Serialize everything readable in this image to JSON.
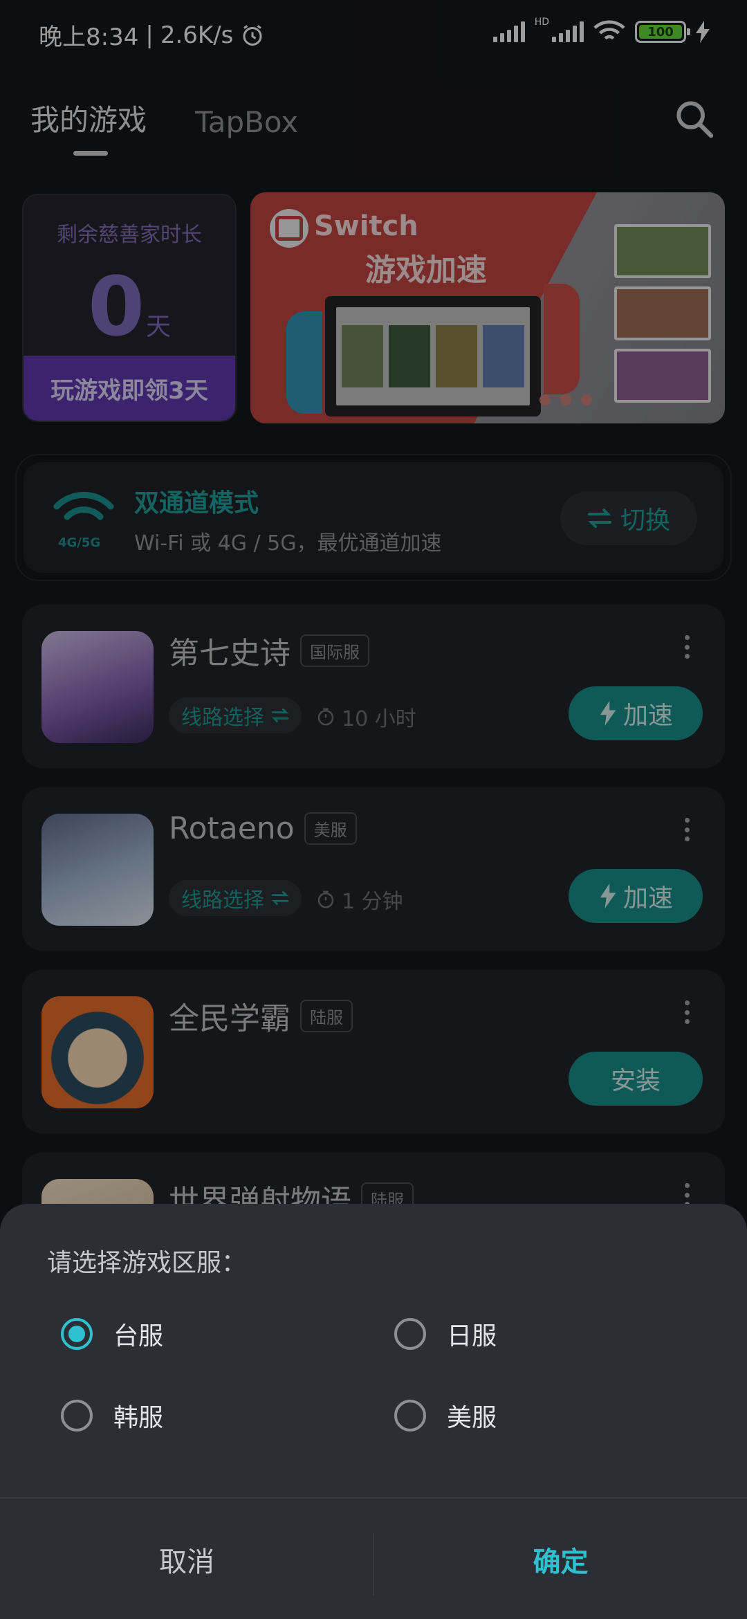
{
  "status_bar": {
    "time": "晚上8:34",
    "net_speed": "2.6K/s",
    "hd_label": "HD",
    "battery": "100"
  },
  "header": {
    "tabs": [
      {
        "label": "我的游戏",
        "active": true
      },
      {
        "label": "TapBox",
        "active": false
      }
    ]
  },
  "welfare": {
    "title": "剩余慈善家时长",
    "value": "0",
    "unit": "天",
    "cta": "玩游戏即领3天"
  },
  "banner": {
    "title": "Switch",
    "subtitle": "游戏加速",
    "page_count": 3
  },
  "dual_channel": {
    "badge": "4G/5G",
    "title": "双通道模式",
    "desc": "Wi-Fi 或 4G / 5G，最优通道加速",
    "button": "切换"
  },
  "games": [
    {
      "name": "第七史诗",
      "server": "国际服",
      "route": "线路选择",
      "duration": "10 小时",
      "action": "加速"
    },
    {
      "name": "Rotaeno",
      "server": "美服",
      "route": "线路选择",
      "duration": "1 分钟",
      "action": "加速"
    },
    {
      "name": "全民学霸",
      "server": "陆服",
      "action": "安装"
    },
    {
      "name": "世界弹射物语",
      "server": "陆服"
    }
  ],
  "dialog": {
    "prompt": "请选择游戏区服：",
    "options": [
      {
        "label": "台服",
        "selected": true
      },
      {
        "label": "日服",
        "selected": false
      },
      {
        "label": "韩服",
        "selected": false
      },
      {
        "label": "美服",
        "selected": false
      }
    ],
    "cancel": "取消",
    "confirm": "确定"
  },
  "colors": {
    "accent": "#2fc1cf",
    "teal_button": "#178b86",
    "welfare_purple": "#5b36a8"
  }
}
